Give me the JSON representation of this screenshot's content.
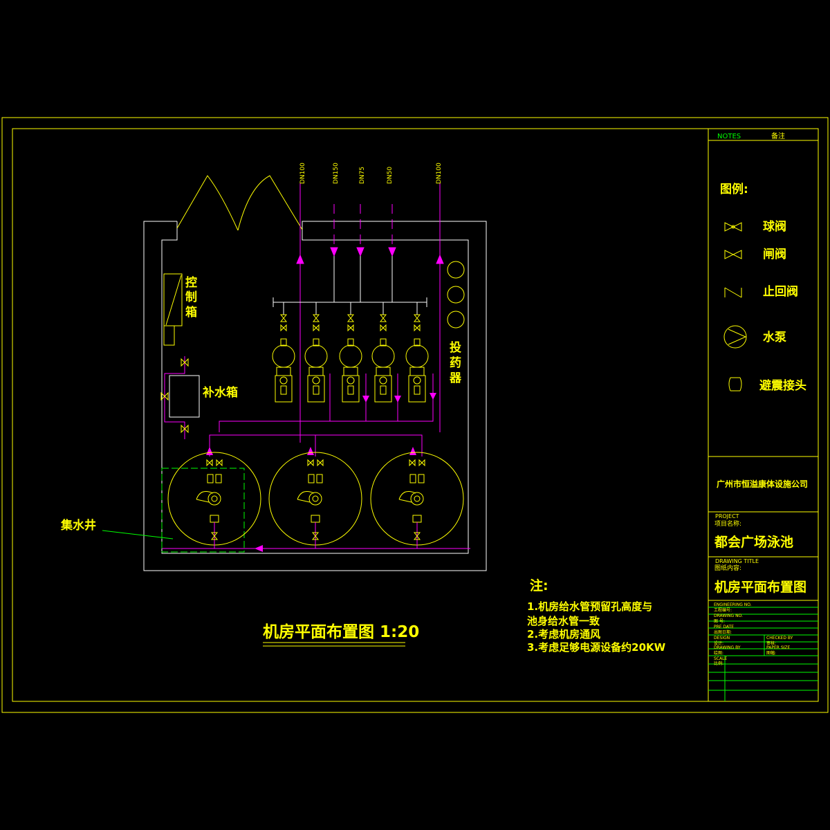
{
  "drawing": {
    "title": "机房平面布置图 1:20",
    "labels": {
      "control_box": "控制箱",
      "makeup_tank": "补水箱",
      "dosing": "投药器",
      "sump": "集水井"
    },
    "pipes": [
      "DN100",
      "DN150",
      "DN75",
      "DN50",
      "DN100"
    ]
  },
  "notes": {
    "heading": "注:",
    "items": [
      "1.机房给水管预留孔高度与",
      "池身给水管一致",
      "2.考虑机房通风",
      "3.考虑足够电源设备约20KW"
    ]
  },
  "legend": {
    "header_en": "NOTES",
    "header_cn": "备注",
    "title": "图例:",
    "items": [
      {
        "icon": "ball-valve-icon",
        "label": "球阀"
      },
      {
        "icon": "gate-valve-icon",
        "label": "闸阀"
      },
      {
        "icon": "check-valve-icon",
        "label": "止回阀"
      },
      {
        "icon": "pump-icon",
        "label": "水泵"
      },
      {
        "icon": "flex-joint-icon",
        "label": "避震接头"
      }
    ]
  },
  "title_block": {
    "company": "广州市恒溢康体设施公司",
    "project_label_en": "PROJECT",
    "project_label_cn": "项目名称:",
    "project_name": "都会广场泳池",
    "drawing_label_en": "DRAWING TITLE",
    "drawing_label_cn": "图纸内容:",
    "drawing_name": "机房平面布置图",
    "fields": {
      "eng_no_en": "ENGINEERING NO.",
      "eng_no_cn": "工程编号:",
      "dwg_no_en": "DRAWING NO.",
      "dwg_no_cn": "图  号:",
      "date_en": "PRE DATE",
      "date_cn": "出图日期:",
      "design_en": "DESIGN",
      "design_cn": "设计:",
      "checked_en": "CHECKED BY",
      "checked_cn": "审核:",
      "drawn_en": "DRAWING BY",
      "drawn_cn": "绘图:",
      "paper_en": "PAPER SIZE",
      "paper_cn": "图幅:",
      "scale_en": "SCALE",
      "scale_cn": "比例:"
    }
  },
  "colors": {
    "background": "#000000",
    "frame": "#ffff00",
    "text": "#ffff00",
    "pipe": "#ff00ff",
    "sump": "#00ff00",
    "table": "#00ff00"
  }
}
